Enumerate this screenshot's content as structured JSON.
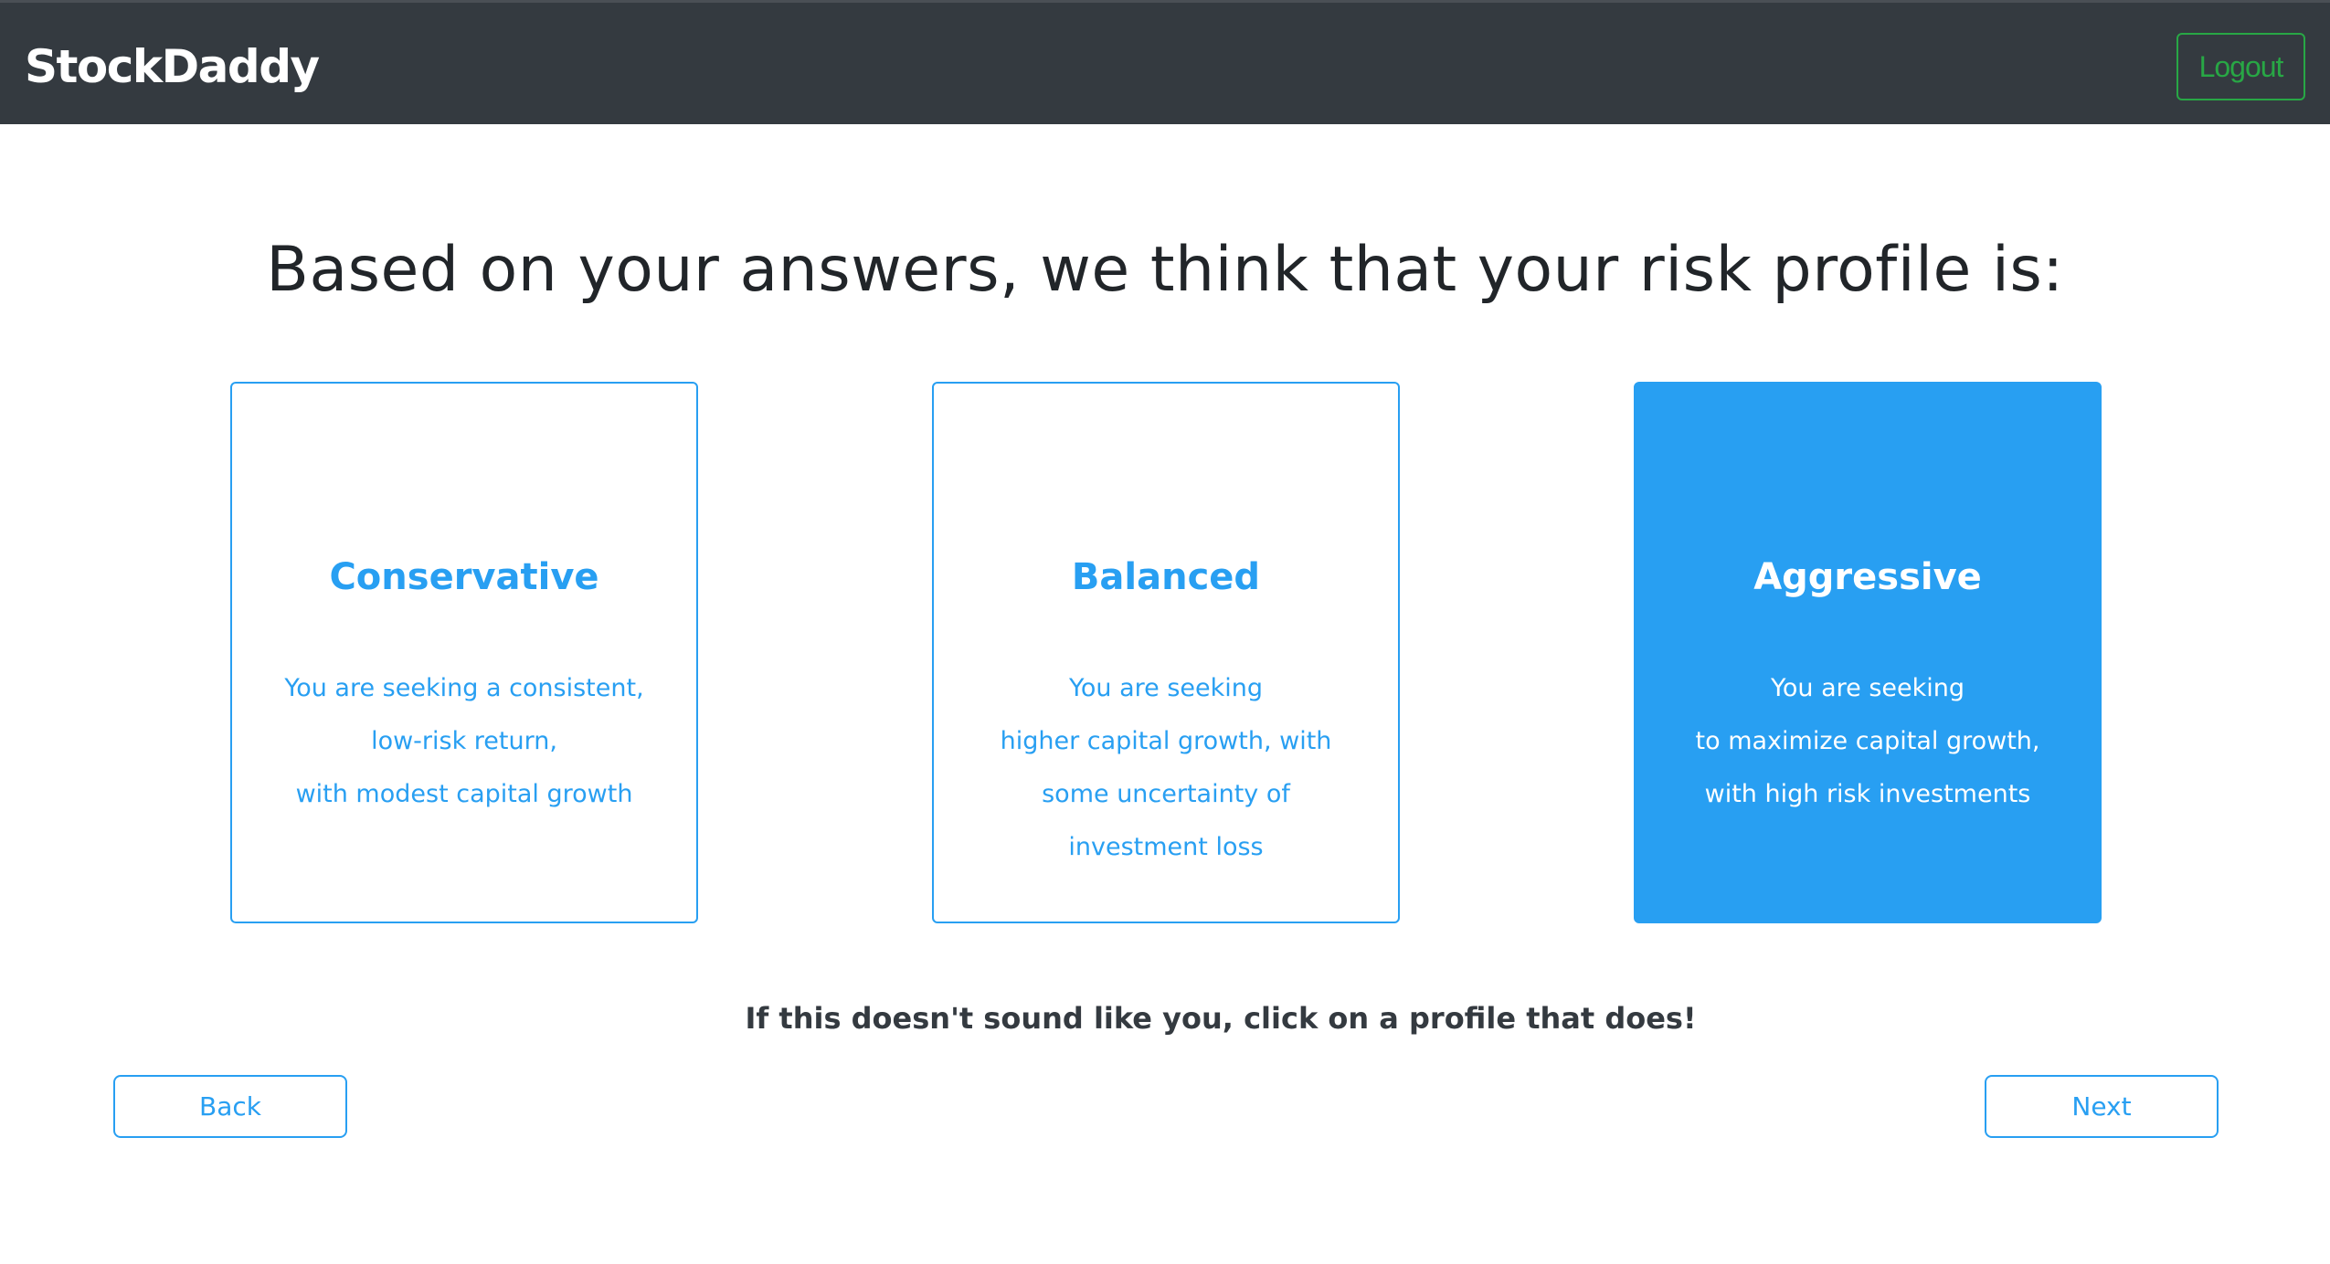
{
  "navbar": {
    "brand": "StockDaddy",
    "logout_label": "Logout"
  },
  "main": {
    "heading": "Based on your answers, we think that your risk profile is:",
    "profiles": [
      {
        "title": "Conservative",
        "description": [
          "You are seeking a consistent,",
          "low-risk return,",
          "with modest capital growth"
        ],
        "selected": false
      },
      {
        "title": "Balanced",
        "description": [
          "You are seeking",
          "higher capital growth, with",
          "some uncertainty of",
          "investment loss"
        ],
        "selected": false
      },
      {
        "title": "Aggressive",
        "description": [
          "You are seeking",
          "to maximize capital growth,",
          "with high risk investments"
        ],
        "selected": true
      }
    ],
    "hint": "If this doesn't sound like you, click on a profile that does!",
    "back_label": "Back",
    "next_label": "Next"
  },
  "colors": {
    "navbar_bg": "#343a40",
    "accent": "#289ff2",
    "logout": "#28a745"
  }
}
